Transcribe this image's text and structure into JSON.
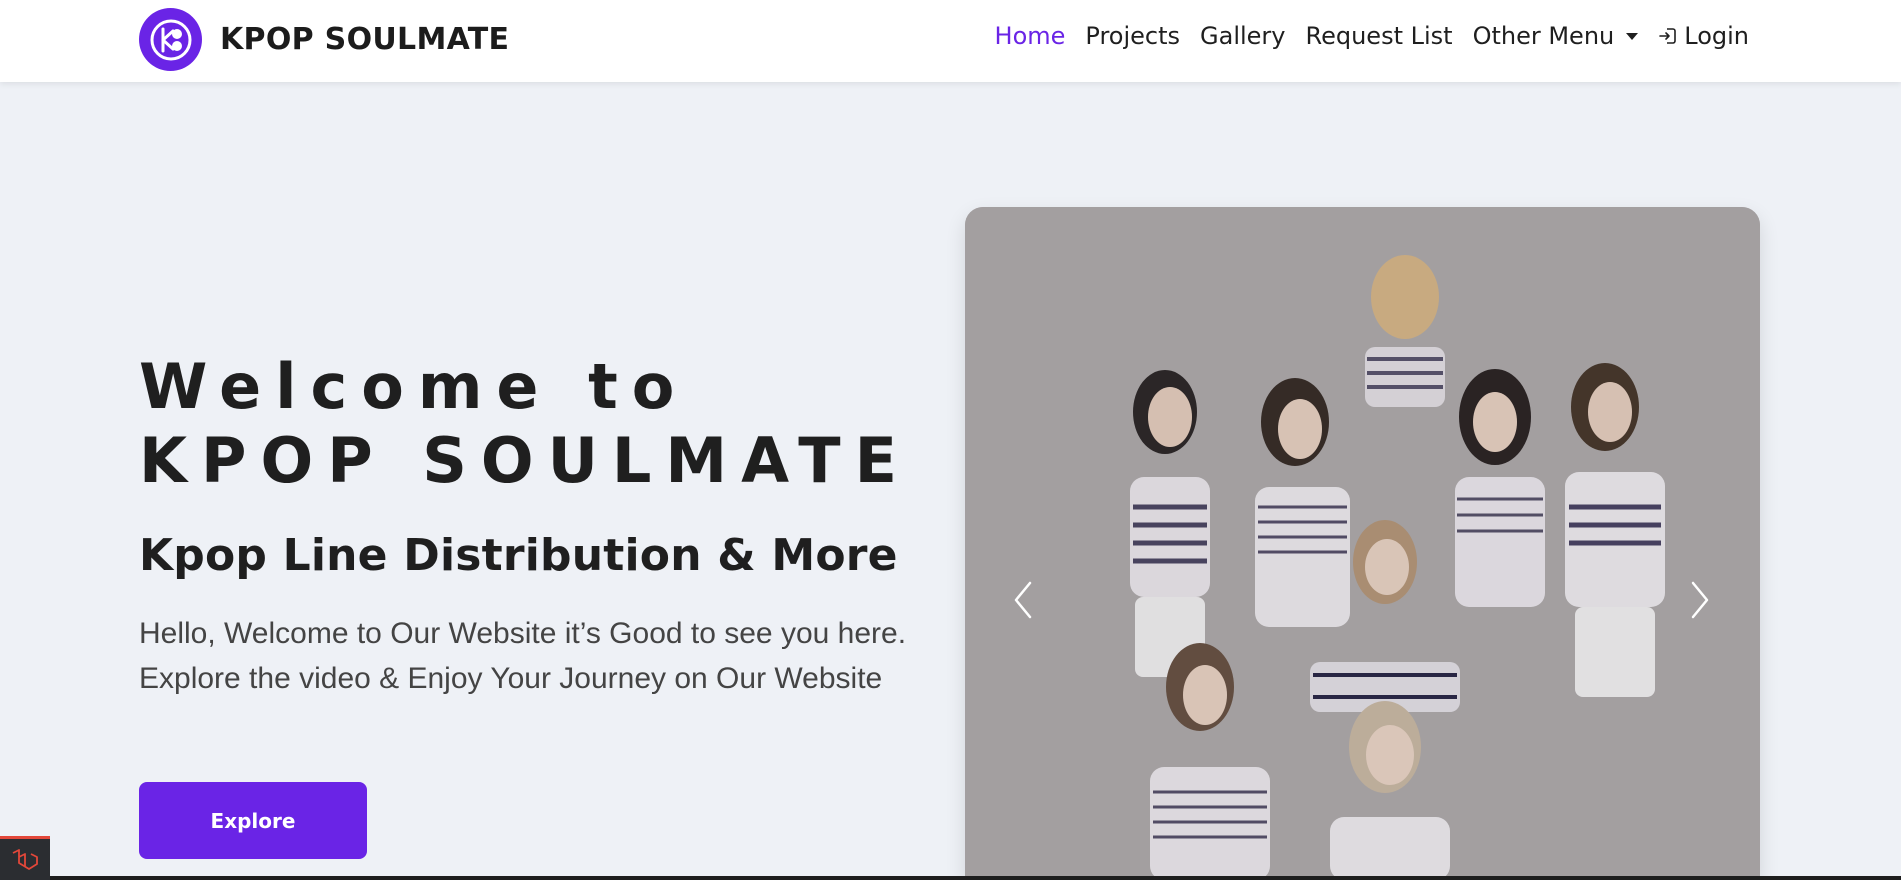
{
  "brand": {
    "name": "KPOP SOULMATE",
    "accent_color": "#6a24e6"
  },
  "nav": {
    "items": [
      {
        "label": "Home",
        "active": true
      },
      {
        "label": "Projects",
        "active": false
      },
      {
        "label": "Gallery",
        "active": false
      },
      {
        "label": "Request List",
        "active": false
      },
      {
        "label": "Other Menu",
        "active": false,
        "has_dropdown": true
      },
      {
        "label": "Login",
        "active": false,
        "icon": "login-icon"
      }
    ]
  },
  "hero": {
    "title_line1": "Welcome to",
    "title_line2": "KPOP SOULMATE",
    "subtitle": "Kpop Line Distribution & More",
    "description": "Hello, Welcome to Our Website it’s Good to see you here. Explore the video & Enjoy Your Journey on Our Website",
    "button_label": "Explore"
  },
  "carousel": {
    "prev_icon": "chevron-left-icon",
    "next_icon": "chevron-right-icon"
  }
}
